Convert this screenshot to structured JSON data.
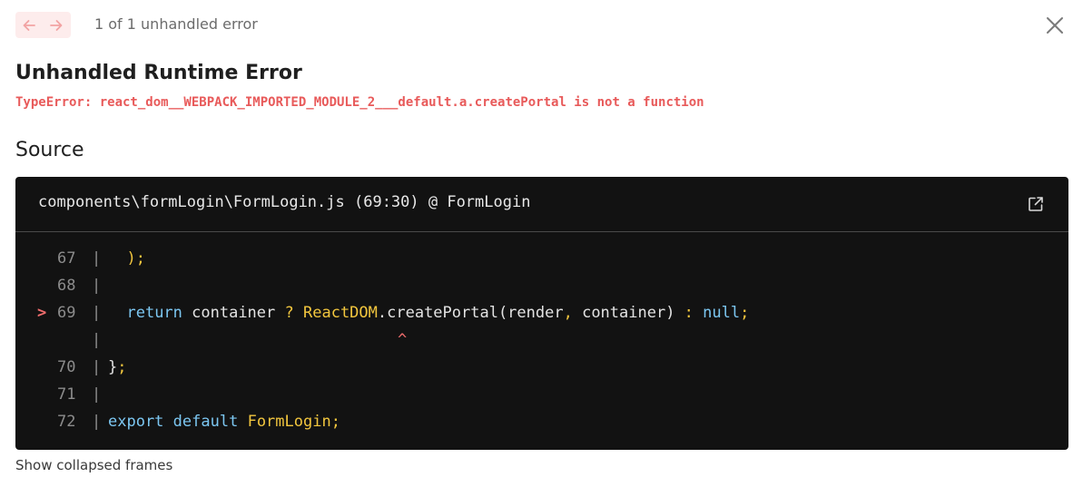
{
  "pagination": {
    "prev_icon": "arrow-left-icon",
    "next_icon": "arrow-right-icon",
    "count_text": "1 of 1 unhandled error"
  },
  "close_icon": "close-icon",
  "error": {
    "title": "Unhandled Runtime Error",
    "message": "TypeError: react_dom__WEBPACK_IMPORTED_MODULE_2___default.a.createPortal is not a function"
  },
  "source": {
    "heading": "Source",
    "file_ref": "components\\formLogin\\FormLogin.js (69:30) @ FormLogin",
    "open_icon": "external-link-icon",
    "lines": [
      {
        "number": "67",
        "marker": "",
        "tokens": [
          {
            "t": "  ",
            "c": ""
          },
          {
            "t": ");",
            "c": "yl"
          }
        ]
      },
      {
        "number": "68",
        "marker": "",
        "tokens": []
      },
      {
        "number": "69",
        "marker": ">",
        "tokens": [
          {
            "t": "  ",
            "c": ""
          },
          {
            "t": "return",
            "c": "kw"
          },
          {
            "t": " container ",
            "c": ""
          },
          {
            "t": "?",
            "c": "yl"
          },
          {
            "t": " ",
            "c": ""
          },
          {
            "t": "ReactDOM",
            "c": "yl"
          },
          {
            "t": ".createPortal(render",
            "c": ""
          },
          {
            "t": ",",
            "c": "yl"
          },
          {
            "t": " container) ",
            "c": ""
          },
          {
            "t": ":",
            "c": "yl"
          },
          {
            "t": " ",
            "c": ""
          },
          {
            "t": "null",
            "c": "kw"
          },
          {
            "t": ";",
            "c": "yl"
          }
        ]
      },
      {
        "number": "",
        "marker": "",
        "caret": "^",
        "tokens": []
      },
      {
        "number": "70",
        "marker": "",
        "tokens": [
          {
            "t": "}",
            "c": ""
          },
          {
            "t": ";",
            "c": "yl"
          }
        ]
      },
      {
        "number": "71",
        "marker": "",
        "tokens": []
      },
      {
        "number": "72",
        "marker": "",
        "tokens": [
          {
            "t": "export",
            "c": "kw"
          },
          {
            "t": " ",
            "c": ""
          },
          {
            "t": "default",
            "c": "kw"
          },
          {
            "t": " ",
            "c": ""
          },
          {
            "t": "FormLogin",
            "c": "yl"
          },
          {
            "t": ";",
            "c": "yl"
          }
        ]
      }
    ]
  },
  "footer": {
    "show_collapsed": "Show collapsed frames"
  },
  "colors": {
    "error_red": "#e85a5a",
    "keyword_blue": "#7cc7f2",
    "highlight_yellow": "#f2c63e",
    "code_bg": "#121212"
  }
}
